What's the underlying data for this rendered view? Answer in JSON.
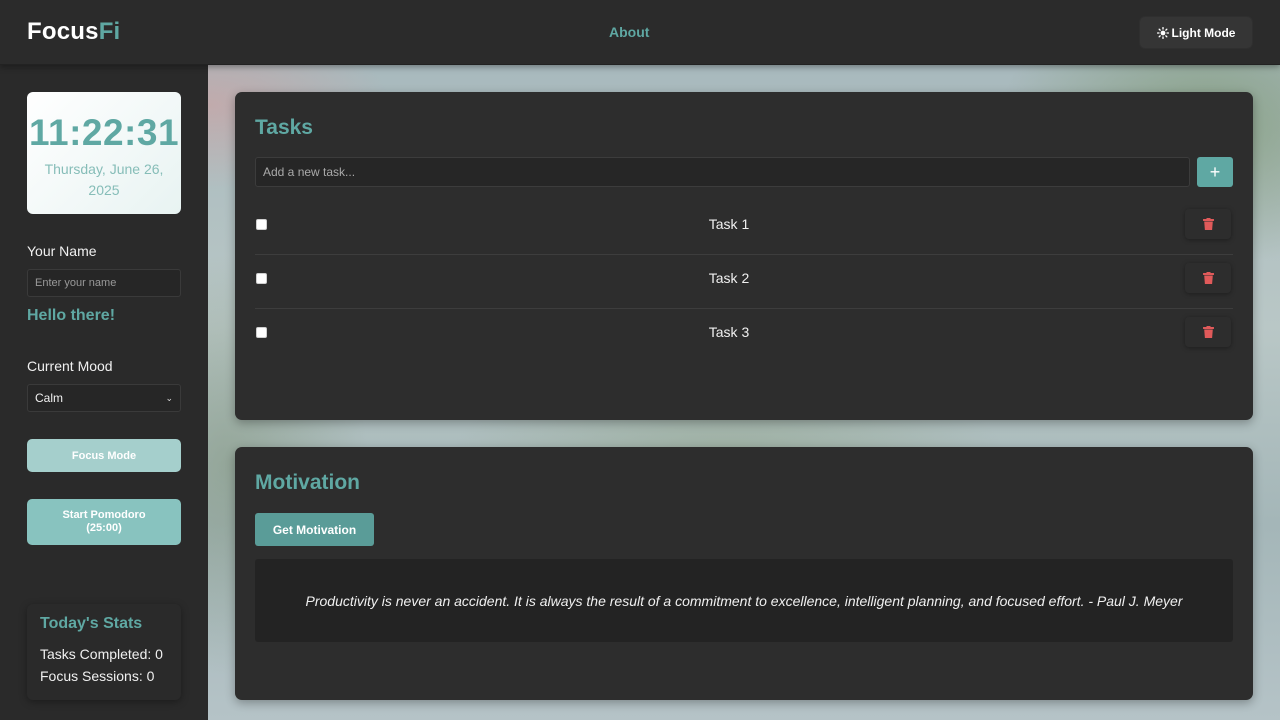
{
  "header": {
    "logo_main": "Focus",
    "logo_accent": "Fi",
    "nav_about": "About",
    "theme_toggle_label": "Light Mode"
  },
  "sidebar": {
    "clock": {
      "time": "11:22:31",
      "date": "Thursday, June 26, 2025"
    },
    "name_label": "Your Name",
    "name_placeholder": "Enter your name",
    "greeting": "Hello there!",
    "mood_label": "Current Mood",
    "mood_selected": "Calm",
    "focus_mode_button": "Focus Mode",
    "pomodoro_button_line1": "Start Pomodoro",
    "pomodoro_button_line2": "(25:00)",
    "stats": {
      "title": "Today's Stats",
      "tasks_completed": "Tasks Completed: 0",
      "focus_sessions": "Focus Sessions: 0"
    }
  },
  "tasks": {
    "title": "Tasks",
    "input_placeholder": "Add a new task...",
    "add_button": "+",
    "items": [
      {
        "label": "Task 1",
        "checked": false
      },
      {
        "label": "Task 2",
        "checked": false
      },
      {
        "label": "Task 3",
        "checked": false
      }
    ]
  },
  "motivation": {
    "title": "Motivation",
    "button": "Get Motivation",
    "quote": "Productivity is never an accident. It is always the result of a commitment to excellence, intelligent planning, and focused effort. - Paul J. Meyer"
  },
  "colors": {
    "accent": "#5fa8a3",
    "delete": "#e05a5a",
    "panel": "#2d2d2d"
  },
  "icons": {
    "theme": "sun-icon",
    "delete": "trash-icon",
    "dropdown": "chevron-down-icon"
  }
}
